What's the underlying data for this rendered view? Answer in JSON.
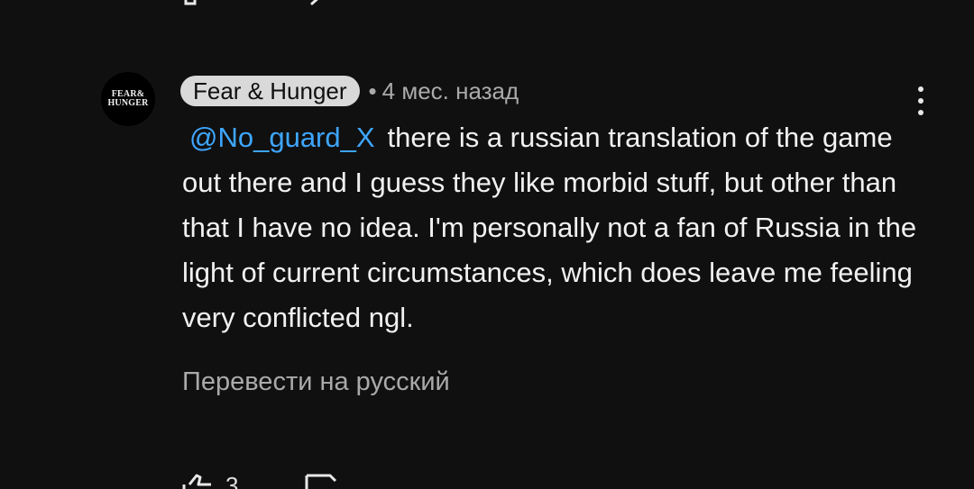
{
  "top_actions": {
    "reply_icon": "reply-icon",
    "edit_icon": "edit-icon"
  },
  "comment": {
    "avatar": {
      "line1": "FEAR&",
      "line2": "HUNGER"
    },
    "author": "Fear & Hunger",
    "separator": "•",
    "time": "4 мес. назад",
    "mention": "@No_guard_X",
    "text": "there is a russian translation of the game out there and I guess they like morbid stuff, but other than that I have no idea. I'm personally not a fan of Russia in the light of current circumstances, which does leave me feeling very conflicted ngl.",
    "translate_label": "Перевести на русский",
    "like_count": "3"
  },
  "colors": {
    "background": "#101010",
    "text": "#f1f1f1",
    "secondary": "#aaaaaa",
    "mention": "#3ea6ff",
    "chip": "#d9d9d9"
  }
}
